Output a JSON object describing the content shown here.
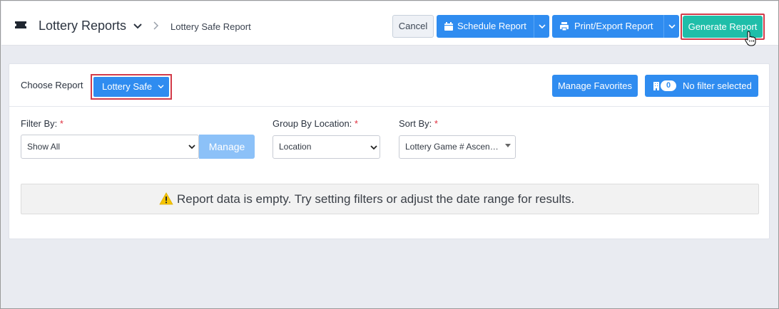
{
  "header": {
    "app_title": "Lottery Reports",
    "breadcrumb": "Lottery Safe Report",
    "cancel_label": "Cancel",
    "schedule_label": "Schedule Report",
    "export_label": "Print/Export Report",
    "generate_label": "Generate Report"
  },
  "report": {
    "choose_label": "Choose Report",
    "selected": "Lottery Safe",
    "manage_favorites_label": "Manage Favorites",
    "filter_count": "0",
    "filter_status": "No filter selected"
  },
  "filters": {
    "filter_by": {
      "label": "Filter By:",
      "required_mark": "*",
      "value": "Show All",
      "manage_label": "Manage"
    },
    "group_by": {
      "label": "Group By Location:",
      "required_mark": "*",
      "value": "Location"
    },
    "sort_by": {
      "label": "Sort By:",
      "required_mark": "*",
      "value": "Lottery Game # Ascen…"
    }
  },
  "empty_state": {
    "message": "Report data is empty. Try setting filters or adjust the date range for results.",
    "icon": "warning-icon"
  },
  "colors": {
    "primary": "#2f8cf0",
    "success": "#1fbea9",
    "highlight_outline": "#d23b4a",
    "warning": "#f5c400"
  }
}
